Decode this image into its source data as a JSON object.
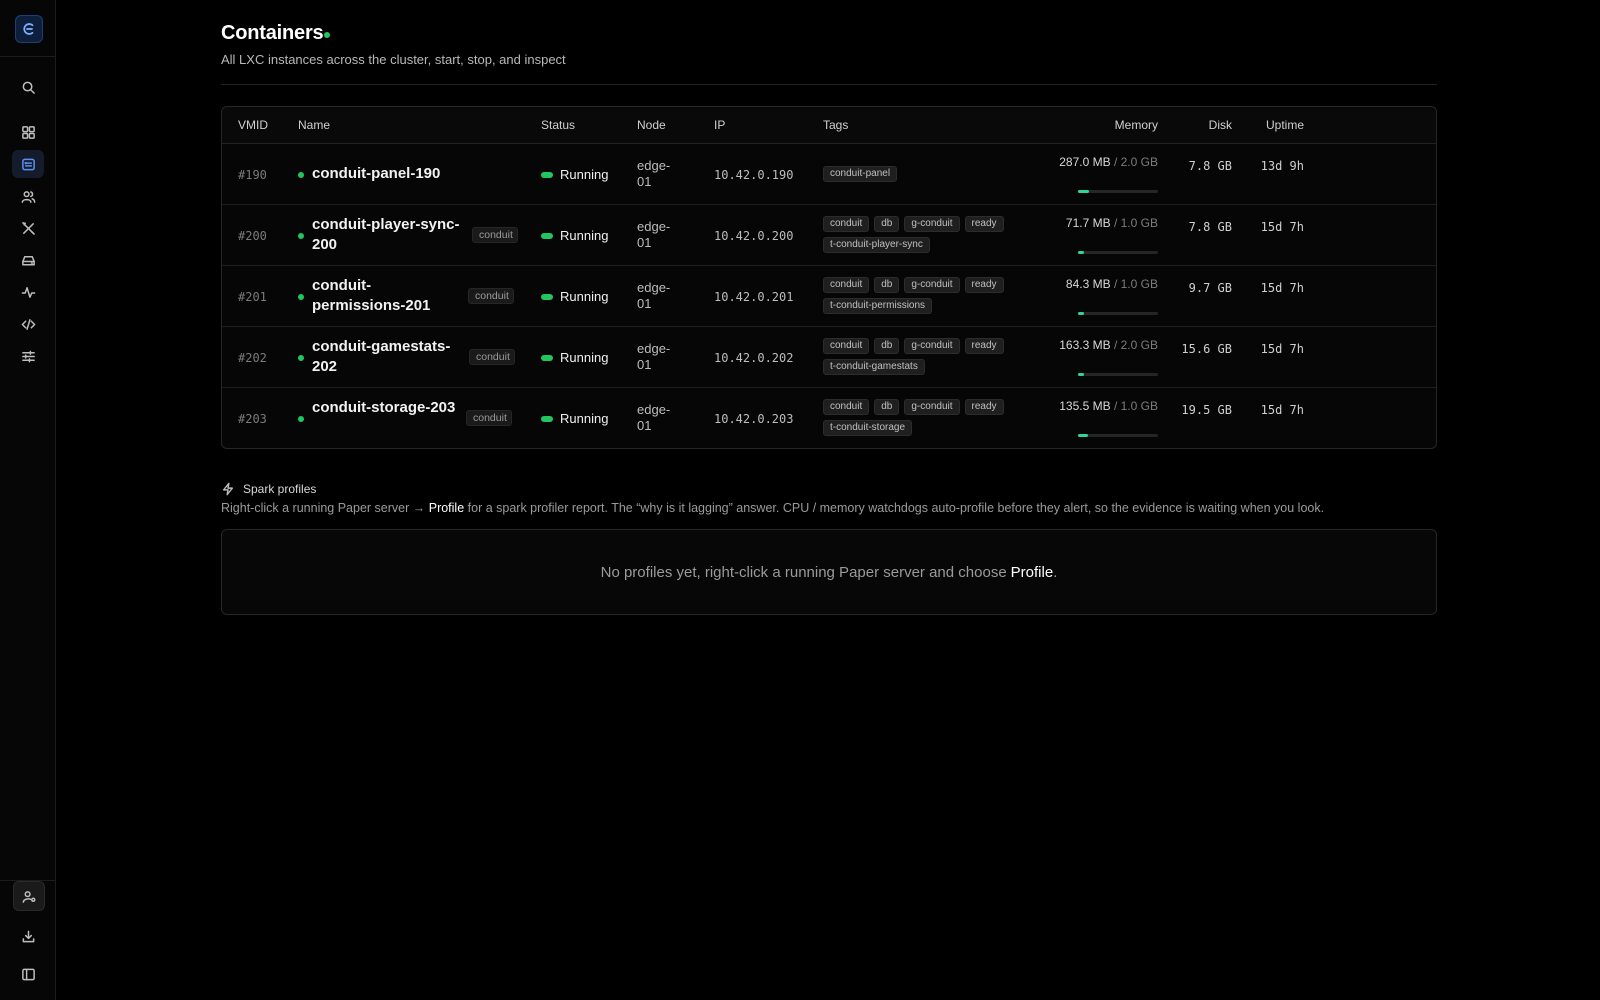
{
  "sidebar": {
    "logo_icon": "conduit-logo-icon",
    "nav": [
      {
        "icon": "search-icon"
      },
      {
        "icon": "dashboard-icon"
      },
      {
        "icon": "containers-icon",
        "active": true
      },
      {
        "icon": "users-icon"
      },
      {
        "icon": "tools-icon"
      },
      {
        "icon": "storage-icon"
      },
      {
        "icon": "activity-icon"
      },
      {
        "icon": "code-icon"
      },
      {
        "icon": "sliders-icon"
      }
    ],
    "bottom": [
      {
        "icon": "user-settings-icon"
      },
      {
        "icon": "download-icon"
      },
      {
        "icon": "sidebar-toggle-icon"
      }
    ]
  },
  "header": {
    "title": "Containers",
    "subtitle": "All LXC instances across the cluster, start, stop, and inspect"
  },
  "table": {
    "columns": {
      "vmid": "VMID",
      "name": "Name",
      "status": "Status",
      "node": "Node",
      "ip": "IP",
      "tags": "Tags",
      "memory": "Memory",
      "disk": "Disk",
      "uptime": "Uptime"
    },
    "rows": [
      {
        "vmid": "#190",
        "name": "conduit-panel-190",
        "name_tag": "",
        "status": "Running",
        "node": "edge-01",
        "ip": "10.42.0.190",
        "tags": [
          "conduit-panel"
        ],
        "mem_used": "287.0 MB",
        "mem_total": "/ 2.0 GB",
        "mem_fraction": 0.14,
        "disk": "7.8 GB",
        "uptime": "13d 9h"
      },
      {
        "vmid": "#200",
        "name": "conduit-player-sync-200",
        "name_tag": "conduit",
        "status": "Running",
        "node": "edge-01",
        "ip": "10.42.0.200",
        "tags": [
          "conduit",
          "db",
          "g-conduit",
          "ready",
          "t-conduit-player-sync"
        ],
        "mem_used": "71.7 MB",
        "mem_total": "/ 1.0 GB",
        "mem_fraction": 0.07,
        "disk": "7.8 GB",
        "uptime": "15d 7h"
      },
      {
        "vmid": "#201",
        "name": "conduit-permissions-201",
        "name_tag": "conduit",
        "status": "Running",
        "node": "edge-01",
        "ip": "10.42.0.201",
        "tags": [
          "conduit",
          "db",
          "g-conduit",
          "ready",
          "t-conduit-permissions"
        ],
        "mem_used": "84.3 MB",
        "mem_total": "/ 1.0 GB",
        "mem_fraction": 0.08,
        "disk": "9.7 GB",
        "uptime": "15d 7h"
      },
      {
        "vmid": "#202",
        "name": "conduit-gamestats-202",
        "name_tag": "conduit",
        "status": "Running",
        "node": "edge-01",
        "ip": "10.42.0.202",
        "tags": [
          "conduit",
          "db",
          "g-conduit",
          "ready",
          "t-conduit-gamestats"
        ],
        "mem_used": "163.3 MB",
        "mem_total": "/ 2.0 GB",
        "mem_fraction": 0.08,
        "disk": "15.6 GB",
        "uptime": "15d 7h"
      },
      {
        "vmid": "#203",
        "name": "conduit-storage-203",
        "name_tag": "conduit",
        "status": "Running",
        "node": "edge-01",
        "ip": "10.42.0.203",
        "tags": [
          "conduit",
          "db",
          "g-conduit",
          "ready",
          "t-conduit-storage"
        ],
        "mem_used": "135.5 MB",
        "mem_total": "/ 1.0 GB",
        "mem_fraction": 0.13,
        "disk": "19.5 GB",
        "uptime": "15d 7h"
      }
    ]
  },
  "spark": {
    "title": "Spark profiles",
    "desc_pre": "Right-click a running Paper server → ",
    "desc_hl": "Profile",
    "desc_post": " for a spark profiler report. The “why is it lagging” answer. CPU / memory watchdogs auto-profile before they alert, so the evidence is waiting when you look.",
    "empty_pre": "No profiles yet, right-click a running Paper server and choose ",
    "empty_hl": "Profile",
    "empty_post": "."
  },
  "colors": {
    "accent": "#5b8ff0",
    "running": "#22c55e",
    "mem_fill": "#2dd4a0",
    "background": "#000000"
  }
}
